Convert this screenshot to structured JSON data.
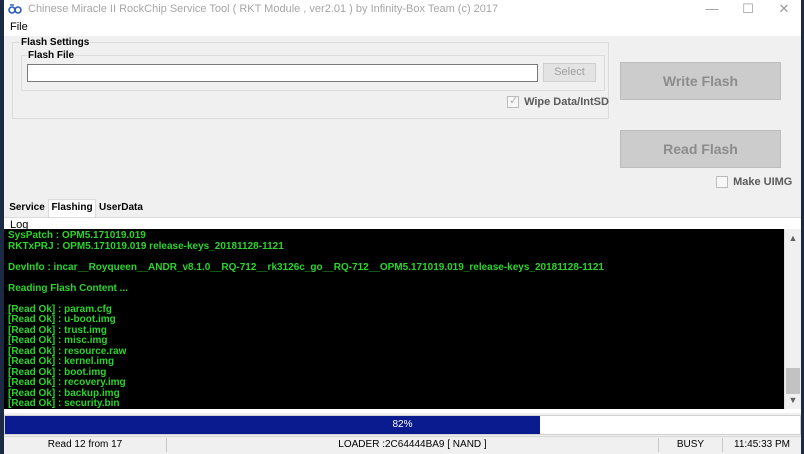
{
  "window": {
    "title": "Chinese Miracle II RockChip Service Tool ( RKT Module , ver2.01 ) by Infinity-Box Team (c) 2017",
    "minimize_glyph": "—",
    "maximize_glyph": "☐",
    "close_glyph": "✕",
    "icon": "infinity-logo-icon"
  },
  "menu": {
    "file": "File"
  },
  "flash_settings": {
    "title": "Flash Settings",
    "flash_file_label": "Flash File",
    "flash_file_value": "",
    "select_label": "Select",
    "wipe_label": "Wipe Data/IntSD",
    "wipe_checked": true
  },
  "actions": {
    "write_flash": "Write Flash",
    "read_flash": "Read Flash",
    "make_uimg": "Make UIMG",
    "make_uimg_checked": false
  },
  "tabs": [
    {
      "label": "Service",
      "active": false
    },
    {
      "label": "Flashing",
      "active": true
    },
    {
      "label": "UserData",
      "active": false
    }
  ],
  "log": {
    "label": "Log",
    "lines": [
      "SysPatch : OPM5.171019.019",
      "RKTxPRJ : OPM5.171019.019 release-keys_20181128-1121",
      "",
      "DevInfo : incar__Royqueen__ANDR_v8.1.0__RQ-712__rk3126c_go__RQ-712__OPM5.171019.019_release-keys_20181128-1121",
      "",
      "Reading Flash Content ...",
      "",
      "[Read Ok] : param.cfg",
      "[Read Ok] : u-boot.img",
      "[Read Ok] : trust.img",
      "[Read Ok] : misc.img",
      "[Read Ok] : resource.raw",
      "[Read Ok] : kernel.img",
      "[Read Ok] : boot.img",
      "[Read Ok] : recovery.img",
      "[Read Ok] : backup.img",
      "[Read Ok] : security.bin"
    ],
    "scroll_up_glyph": "▲",
    "scroll_down_glyph": "▼"
  },
  "progress": {
    "value": 82,
    "text": "82%",
    "color": "#0a1a8f"
  },
  "status": {
    "read_count": "Read 12 from 17",
    "loader": "LOADER :2C64444BA9 [ NAND ]",
    "state": "BUSY",
    "time": "11:45:33 PM"
  },
  "colors": {
    "log_text": "#2bd42b",
    "log_bg": "#000000",
    "button_disabled": "#cccccc"
  }
}
